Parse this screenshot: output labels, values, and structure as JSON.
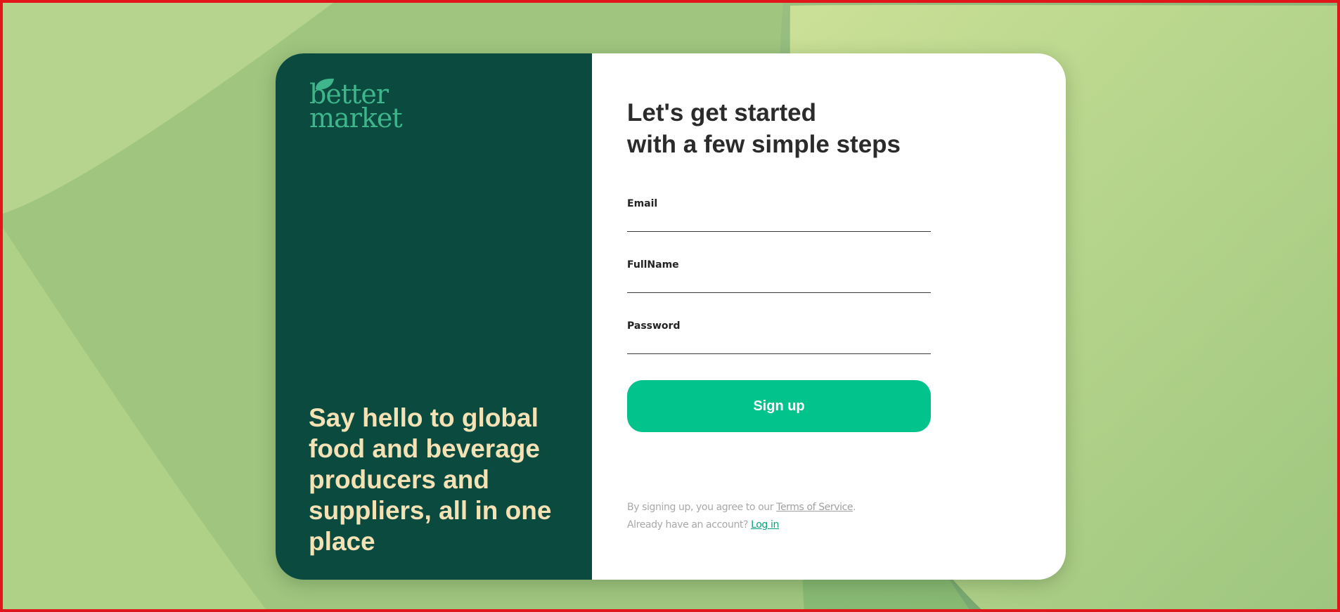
{
  "brand": {
    "logo_line1": "better",
    "logo_line2": "market",
    "logo_icon": "leaf-icon",
    "color_primary_dark": "#0a4a3f",
    "color_logo": "#3fb58b",
    "color_tagline": "#f4e1b4",
    "color_accent": "#02c38c"
  },
  "left_panel": {
    "tagline": "Say hello to global food and beverage producers and suppliers, all in one place"
  },
  "form": {
    "heading_line1": "Let's get started",
    "heading_line2": "with a few simple steps",
    "email_label": "Email",
    "fullname_label": "FullName",
    "password_label": "Password",
    "email_value": "",
    "fullname_value": "",
    "password_value": "",
    "submit_label": "Sign up"
  },
  "legal": {
    "agree_prefix": "By signing up, you agree to our ",
    "terms_link": "Terms of Service",
    "agree_suffix": ".",
    "account_prefix": "Already have an account? ",
    "login_link": "Log in"
  }
}
